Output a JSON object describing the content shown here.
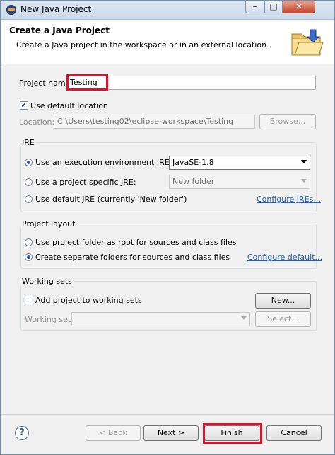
{
  "window": {
    "title": "New Java Project",
    "controls": {
      "minimize": "–",
      "maximize": "□",
      "close": "✕"
    }
  },
  "banner": {
    "title": "Create a Java Project",
    "description": "Create a Java project in the workspace or in an external location.",
    "icon": "folder-icon"
  },
  "project": {
    "name_label": "Project name:",
    "name_value": "Testing",
    "use_default_location_label": "Use default location",
    "use_default_location_checked": true,
    "location_label": "Location:",
    "location_value": "C:\\Users\\testing02\\eclipse-workspace\\Testing",
    "browse_label": "Browse..."
  },
  "jre": {
    "group_title": "JRE",
    "options": [
      {
        "label": "Use an execution environment JRE:",
        "selected": true,
        "value": "JavaSE-1.8"
      },
      {
        "label": "Use a project specific JRE:",
        "selected": false,
        "value": "New folder"
      },
      {
        "label": "Use default JRE (currently 'New folder')",
        "selected": false
      }
    ],
    "configure_link": "Configure JREs..."
  },
  "layout": {
    "group_title": "Project layout",
    "options": [
      {
        "label": "Use project folder as root for sources and class files",
        "selected": false
      },
      {
        "label": "Create separate folders for sources and class files",
        "selected": true
      }
    ],
    "configure_link": "Configure default..."
  },
  "working_sets": {
    "group_title": "Working sets",
    "add_label": "Add project to working sets",
    "add_checked": false,
    "new_button": "New...",
    "sets_label": "Working sets:",
    "select_button": "Select..."
  },
  "footer": {
    "help_icon": "?",
    "back_button": "< Back",
    "next_button": "Next >",
    "finish_button": "Finish",
    "cancel_button": "Cancel"
  },
  "colors": {
    "highlight": "#e0112b",
    "link": "#1a5ec2",
    "accent": "#2c5ca8"
  }
}
